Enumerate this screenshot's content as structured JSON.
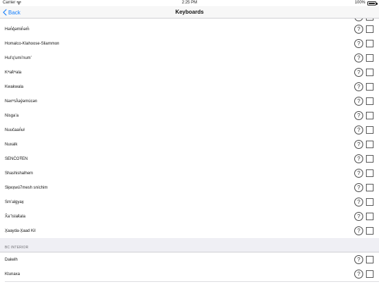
{
  "status_bar": {
    "carrier": "Carrier",
    "time": "2:25 PM",
    "battery": "100%"
  },
  "nav": {
    "back_label": "Back",
    "title": "Keyboards"
  },
  "help_glyph": "?",
  "list_top": [
    "Hən̓q̓əmin̓əm̓",
    "Homalco-Klahoose-Sliammon",
    "Hul’q’umi’num’",
    "Kʷak̓ʷala",
    "Kwakwala",
    "Nəxʷsƛ̓ay̓əmúcən",
    "Nisga’a",
    "Nuučaan̓uł",
    "Nuxalk",
    "SENĆOŦEN",
    "Shashishalhem",
    "Sḵwx̱wú7mesh sníchim",
    "Sm’algyax̱",
    "X̌a’’islak̓ala",
    "X̱aayda-X̱aad Kil"
  ],
  "section": {
    "header": "BC INTERIOR",
    "items": [
      "Dakelh",
      "Ktunaxa"
    ]
  }
}
